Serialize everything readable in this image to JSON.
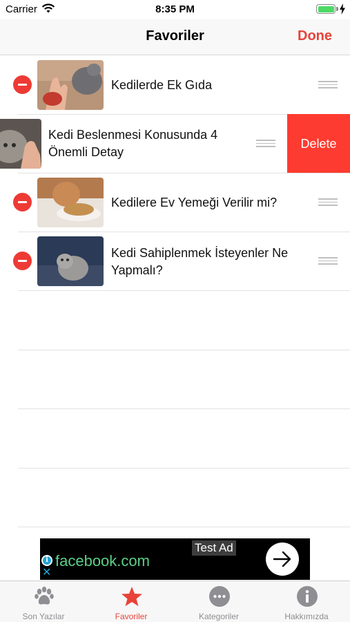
{
  "status_bar": {
    "carrier": "Carrier",
    "time": "8:35 PM",
    "icons": [
      "wifi-icon",
      "battery-icon",
      "charging-bolt-icon"
    ]
  },
  "nav": {
    "title": "Favoriler",
    "done_label": "Done"
  },
  "articles": [
    {
      "title": "Kedilerde Ek Gıda",
      "thumbnail": "cat-and-hand-photo"
    },
    {
      "title": "Kedi Beslenmesi Konusunda 4 Önemli Detay",
      "thumbnail": "cat-eating-from-hand-photo",
      "swiped": true,
      "delete_label": "Delete"
    },
    {
      "title": "Kedilere Ev Yemeği Verilir mi?",
      "thumbnail": "cat-with-food-plate-photo"
    },
    {
      "title": "Kedi Sahiplenmek İsteyenler Ne Yapmalı?",
      "thumbnail": "gray-kitten-photo"
    }
  ],
  "ad": {
    "test_label": "Test Ad",
    "text": "facebook.com",
    "icons": [
      "info-icon",
      "close-icon",
      "arrow-right-icon"
    ]
  },
  "tabs": [
    {
      "label": "Son Yazılar",
      "icon": "paw-icon",
      "active": false
    },
    {
      "label": "Favoriler",
      "icon": "star-icon",
      "active": true
    },
    {
      "label": "Kategoriler",
      "icon": "more-icon",
      "active": false
    },
    {
      "label": "Hakkımızda",
      "icon": "info-icon",
      "active": false
    }
  ],
  "colors": {
    "accent": "#e8433a",
    "delete": "#fe3b30",
    "delete_circle": "#ee3a35",
    "tab_inactive": "#8e8e93",
    "ad_text": "#5ccf88"
  }
}
